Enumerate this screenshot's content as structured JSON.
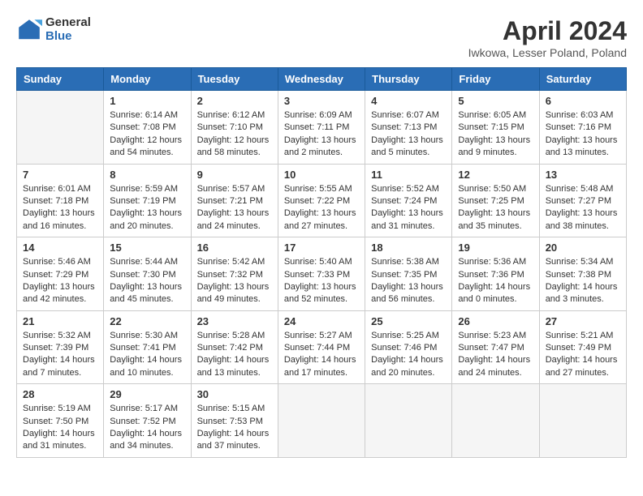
{
  "header": {
    "logo_general": "General",
    "logo_blue": "Blue",
    "month_title": "April 2024",
    "location": "Iwkowa, Lesser Poland, Poland"
  },
  "weekdays": [
    "Sunday",
    "Monday",
    "Tuesday",
    "Wednesday",
    "Thursday",
    "Friday",
    "Saturday"
  ],
  "days": [
    {
      "day": "",
      "empty": true
    },
    {
      "day": "1",
      "sunrise": "6:14 AM",
      "sunset": "7:08 PM",
      "daylight": "12 hours and 54 minutes."
    },
    {
      "day": "2",
      "sunrise": "6:12 AM",
      "sunset": "7:10 PM",
      "daylight": "12 hours and 58 minutes."
    },
    {
      "day": "3",
      "sunrise": "6:09 AM",
      "sunset": "7:11 PM",
      "daylight": "13 hours and 2 minutes."
    },
    {
      "day": "4",
      "sunrise": "6:07 AM",
      "sunset": "7:13 PM",
      "daylight": "13 hours and 5 minutes."
    },
    {
      "day": "5",
      "sunrise": "6:05 AM",
      "sunset": "7:15 PM",
      "daylight": "13 hours and 9 minutes."
    },
    {
      "day": "6",
      "sunrise": "6:03 AM",
      "sunset": "7:16 PM",
      "daylight": "13 hours and 13 minutes."
    },
    {
      "day": "7",
      "sunrise": "6:01 AM",
      "sunset": "7:18 PM",
      "daylight": "13 hours and 16 minutes."
    },
    {
      "day": "8",
      "sunrise": "5:59 AM",
      "sunset": "7:19 PM",
      "daylight": "13 hours and 20 minutes."
    },
    {
      "day": "9",
      "sunrise": "5:57 AM",
      "sunset": "7:21 PM",
      "daylight": "13 hours and 24 minutes."
    },
    {
      "day": "10",
      "sunrise": "5:55 AM",
      "sunset": "7:22 PM",
      "daylight": "13 hours and 27 minutes."
    },
    {
      "day": "11",
      "sunrise": "5:52 AM",
      "sunset": "7:24 PM",
      "daylight": "13 hours and 31 minutes."
    },
    {
      "day": "12",
      "sunrise": "5:50 AM",
      "sunset": "7:25 PM",
      "daylight": "13 hours and 35 minutes."
    },
    {
      "day": "13",
      "sunrise": "5:48 AM",
      "sunset": "7:27 PM",
      "daylight": "13 hours and 38 minutes."
    },
    {
      "day": "14",
      "sunrise": "5:46 AM",
      "sunset": "7:29 PM",
      "daylight": "13 hours and 42 minutes."
    },
    {
      "day": "15",
      "sunrise": "5:44 AM",
      "sunset": "7:30 PM",
      "daylight": "13 hours and 45 minutes."
    },
    {
      "day": "16",
      "sunrise": "5:42 AM",
      "sunset": "7:32 PM",
      "daylight": "13 hours and 49 minutes."
    },
    {
      "day": "17",
      "sunrise": "5:40 AM",
      "sunset": "7:33 PM",
      "daylight": "13 hours and 52 minutes."
    },
    {
      "day": "18",
      "sunrise": "5:38 AM",
      "sunset": "7:35 PM",
      "daylight": "13 hours and 56 minutes."
    },
    {
      "day": "19",
      "sunrise": "5:36 AM",
      "sunset": "7:36 PM",
      "daylight": "14 hours and 0 minutes."
    },
    {
      "day": "20",
      "sunrise": "5:34 AM",
      "sunset": "7:38 PM",
      "daylight": "14 hours and 3 minutes."
    },
    {
      "day": "21",
      "sunrise": "5:32 AM",
      "sunset": "7:39 PM",
      "daylight": "14 hours and 7 minutes."
    },
    {
      "day": "22",
      "sunrise": "5:30 AM",
      "sunset": "7:41 PM",
      "daylight": "14 hours and 10 minutes."
    },
    {
      "day": "23",
      "sunrise": "5:28 AM",
      "sunset": "7:42 PM",
      "daylight": "14 hours and 13 minutes."
    },
    {
      "day": "24",
      "sunrise": "5:27 AM",
      "sunset": "7:44 PM",
      "daylight": "14 hours and 17 minutes."
    },
    {
      "day": "25",
      "sunrise": "5:25 AM",
      "sunset": "7:46 PM",
      "daylight": "14 hours and 20 minutes."
    },
    {
      "day": "26",
      "sunrise": "5:23 AM",
      "sunset": "7:47 PM",
      "daylight": "14 hours and 24 minutes."
    },
    {
      "day": "27",
      "sunrise": "5:21 AM",
      "sunset": "7:49 PM",
      "daylight": "14 hours and 27 minutes."
    },
    {
      "day": "28",
      "sunrise": "5:19 AM",
      "sunset": "7:50 PM",
      "daylight": "14 hours and 31 minutes."
    },
    {
      "day": "29",
      "sunrise": "5:17 AM",
      "sunset": "7:52 PM",
      "daylight": "14 hours and 34 minutes."
    },
    {
      "day": "30",
      "sunrise": "5:15 AM",
      "sunset": "7:53 PM",
      "daylight": "14 hours and 37 minutes."
    },
    {
      "day": "",
      "empty": true
    },
    {
      "day": "",
      "empty": true
    },
    {
      "day": "",
      "empty": true
    },
    {
      "day": "",
      "empty": true
    }
  ]
}
